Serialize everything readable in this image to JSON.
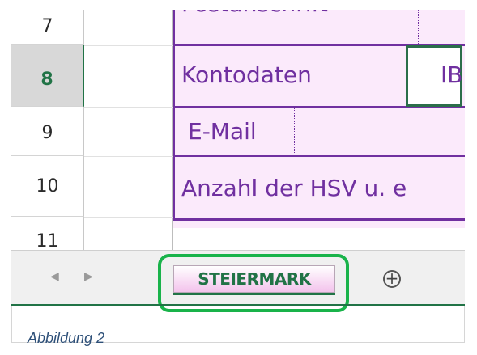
{
  "rows": [
    {
      "number": "7",
      "active": false
    },
    {
      "number": "8",
      "active": true
    },
    {
      "number": "9",
      "active": false
    },
    {
      "number": "10",
      "active": false
    },
    {
      "number": "11",
      "active": false
    }
  ],
  "cells": {
    "row7_partial": "Postanschrift",
    "row8_label": "Kontodaten",
    "row8_value": "IB",
    "row9_label": "E-Mail",
    "row10_label": "Anzahl der HSV u. e"
  },
  "tabs": {
    "active_sheet": "STEIERMARK",
    "prev_arrow": "◀",
    "next_arrow": "▶",
    "add_sheet": "+"
  },
  "colors": {
    "accent": "#217346",
    "cell_fill": "#fbeafb",
    "text_purple": "#7030a0",
    "highlight": "#19b34a"
  },
  "caption": "Abbildung 2"
}
